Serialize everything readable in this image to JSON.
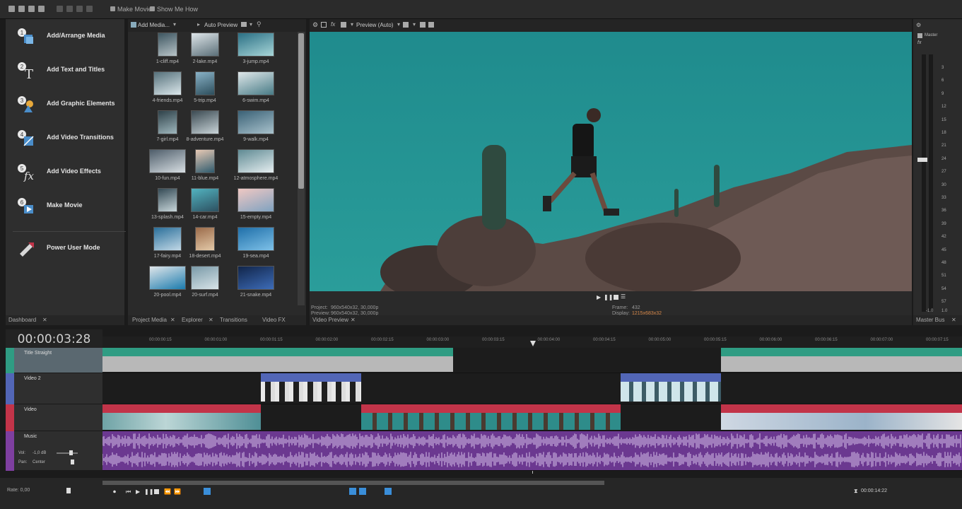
{
  "topbar": {
    "make_movie": "Make Movie",
    "show_me_how": "Show Me How"
  },
  "dashboard": {
    "items": [
      {
        "label": "Add/Arrange Media",
        "icon": "arrange-media-icon"
      },
      {
        "label": "Add Text and Titles",
        "icon": "text-titles-icon"
      },
      {
        "label": "Add Graphic Elements",
        "icon": "graphic-elements-icon"
      },
      {
        "label": "Add Video Transitions",
        "icon": "video-transitions-icon"
      },
      {
        "label": "Add Video Effects",
        "icon": "video-effects-icon"
      },
      {
        "label": "Make Movie",
        "icon": "make-movie-icon"
      }
    ],
    "power_user_mode": "Power User Mode",
    "tab": "Dashboard"
  },
  "media": {
    "add_media": "Add Media...",
    "auto_preview": "Auto Preview",
    "files": [
      "1-cliff.mp4",
      "2-lake.mp4",
      "3-jump.mp4",
      "4-friends.mp4",
      "5-trip.mp4",
      "6-swim.mp4",
      "7-girl.mp4",
      "8-adventure.mp4",
      "9-walk.mp4",
      "10-fun.mp4",
      "11-blue.mp4",
      "12-atmosphere.mp4",
      "13-splash.mp4",
      "14-car.mp4",
      "15-empty.mp4",
      "17-fairy.mp4",
      "18-desert.mp4",
      "19-sea.mp4",
      "20-pool.mp4",
      "20-surf.mp4",
      "21-snake.mp4"
    ],
    "tabs": [
      "Project Media",
      "Explorer",
      "Transitions",
      "Video FX"
    ]
  },
  "preview": {
    "mode": "Preview (Auto)",
    "project_label": "Project:",
    "project_value": "960x540x32, 30,000p",
    "preview_label": "Preview:",
    "preview_value": "960x540x32, 30,000p",
    "frame_label": "Frame:",
    "frame_value": "432",
    "display_label": "Display:",
    "display_value": "1215x683x32",
    "tab": "Video Preview"
  },
  "master": {
    "label": "Master",
    "db_marks": [
      "3",
      "6",
      "9",
      "12",
      "15",
      "18",
      "21",
      "24",
      "27",
      "30",
      "33",
      "36",
      "39",
      "42",
      "45",
      "48",
      "51",
      "54",
      "57"
    ],
    "bottom_left": "-1.0",
    "bottom_right": "1.0",
    "tab": "Master Bus"
  },
  "timeline": {
    "timecode": "00:00:03:28",
    "ruler_ticks": [
      "00:00:00:15",
      "00:00:01:00",
      "00:00:01:15",
      "00:00:02:00",
      "00:00:02:15",
      "00:00:03:00",
      "00:00:03:15",
      "00:00:04:00",
      "00:00:04:15",
      "00:00:05:00",
      "00:00:05:15",
      "00:00:06:00",
      "00:00:06:15",
      "00:00:07:00",
      "00:00:07:15"
    ],
    "tracks": [
      {
        "name": "Title Straight",
        "color": "#2f9c83"
      },
      {
        "name": "Video 2",
        "color": "#5266b6"
      },
      {
        "name": "Video",
        "color": "#c23449"
      },
      {
        "name": "Music",
        "color": "#7e3fa0"
      }
    ],
    "vol_label": "Vol:",
    "vol_value": "-1,0 dB",
    "pan_label": "Pan:",
    "pan_value": "Center"
  },
  "bottom": {
    "rate": "Rate: 0,00",
    "end_time": "00:00:14:22"
  },
  "colors": {
    "title_track": "#2f9c83",
    "video2_track": "#5266b6",
    "video_track": "#c23449",
    "music_track": "#7e3fa0"
  }
}
